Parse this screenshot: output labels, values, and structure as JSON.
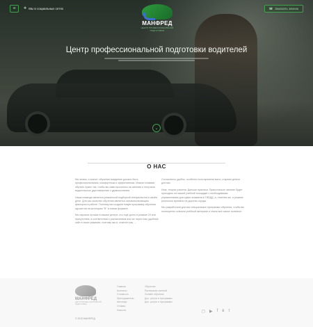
{
  "header": {
    "menu_icon": "hamburger-icon",
    "social_label": "Мы в социальных сетях",
    "social_icon": "share-icon",
    "order_label": "Заказать звонок",
    "order_icon": "phone-icon"
  },
  "logo": {
    "name": "МАНФРЕД",
    "tagline": "ЦЕНТР ПРОФЕССИОНАЛЬНОЙ ПОДГОТОВКИ"
  },
  "hero": {
    "title": "Центр профессиональной подготовки водителей",
    "down_icon": "arrow-down-icon"
  },
  "about": {
    "title": "О НАС",
    "left": [
      "Мы знаем, а значит, обучение вождению должно быть профессиональным, комфортным и эффективным. Иными словами, обучать нужно так, чтобы вы сами просились на занятия и получали водительское удостоверение с удовольствием.",
      "Наша команда является уникальной подборкой специалистов в своём деле. Для нас качество обучения является основополагающим фактором в работе. Поэтому мы создали новую программу обучения курсантов на категорию \"В\" в новом формате.",
      "Мы изучили лучшие в нашем центре, кто ещё долго в режиме 24 или присутствия, в соответствии с расписанием или же через наш удобный сайт в своих режимах, поэтому мы в, отмечен как, ..."
    ],
    "right": [
      "Согласитесь удобно, особенно если времени мало, а время деньги для вас.",
      "Итак, теория усвоена. Дальше практика. Практическое занятие будет проходить на нашей учебной площадке с необходимыми упражнениями для сдачи экзамена в ГИБДД, а, отметим же, в режиме реального времени на дорогах города.",
      "Мы разработали для вас специальные программы обучения, чтобы вы полноценно освоили учебный материал и знали все самое полезное."
    ]
  },
  "footer": {
    "logo_name": "МАНФРЕД",
    "logo_tagline": "ЦЕНТР ПРОФЕССИОНАЛЬНОЙ ПОДГОТОВКИ",
    "copyright": "© 2015 МАНФРЕД",
    "links_1": [
      "Главная",
      "Контакты",
      "Стоимость",
      "Преподаватели",
      "Автопарк",
      "Отзывы",
      "Новости"
    ],
    "links_2": [
      "Обучение",
      "Расписание занятий",
      "Онлайн обучение",
      "Доп. услуги и программы",
      "Доп. услуги и программы"
    ],
    "social_icons": [
      "instagram-icon",
      "youtube-icon",
      "facebook-icon",
      "vk-icon",
      "twitter-icon"
    ]
  }
}
